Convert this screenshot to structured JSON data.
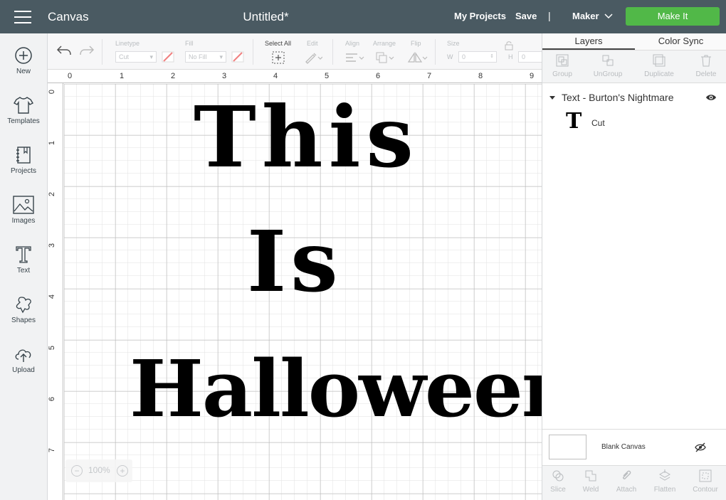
{
  "topbar": {
    "app_title": "Canvas",
    "doc_title": "Untitled*",
    "my_projects": "My Projects",
    "save": "Save",
    "separator": "|",
    "machine": "Maker",
    "make_it": "Make It",
    "background_color": "#4a5a62",
    "make_it_color": "#51b848"
  },
  "leftnav": {
    "items": [
      {
        "label": "New",
        "icon": "plus-circle-icon"
      },
      {
        "label": "Templates",
        "icon": "shirt-icon"
      },
      {
        "label": "Projects",
        "icon": "notebook-icon"
      },
      {
        "label": "Images",
        "icon": "image-icon"
      },
      {
        "label": "Text",
        "icon": "text-icon"
      },
      {
        "label": "Shapes",
        "icon": "shapes-icon"
      },
      {
        "label": "Upload",
        "icon": "cloud-upload-icon"
      }
    ]
  },
  "toolbar": {
    "linetype_label": "Linetype",
    "linetype_value": "Cut",
    "fill_label": "Fill",
    "fill_value": "No Fill",
    "select_all_label": "Select All",
    "edit_label": "Edit",
    "align_label": "Align",
    "arrange_label": "Arrange",
    "flip_label": "Flip",
    "size_label": "Size",
    "w_label": "W",
    "w_value": "0",
    "h_label": "H",
    "h_value": "0"
  },
  "canvas": {
    "ruler_top": [
      "0",
      "1",
      "2",
      "3",
      "4",
      "5",
      "6",
      "7",
      "8",
      "9"
    ],
    "ruler_left": [
      "0",
      "1",
      "2",
      "3",
      "4",
      "5",
      "6",
      "7"
    ],
    "text_lines": [
      "This",
      "Is",
      "Halloween"
    ],
    "zoom_level": "100%"
  },
  "rightpanel": {
    "tabs": [
      "Layers",
      "Color Sync"
    ],
    "actions": [
      "Group",
      "UnGroup",
      "Duplicate",
      "Delete"
    ],
    "layer_group_name": "Text - Burton's Nightmare",
    "layer_item_thumb": "T",
    "layer_item_name": "Cut",
    "blank_canvas_label": "Blank Canvas",
    "bottom_actions": [
      "Slice",
      "Weld",
      "Attach",
      "Flatten",
      "Contour"
    ]
  }
}
